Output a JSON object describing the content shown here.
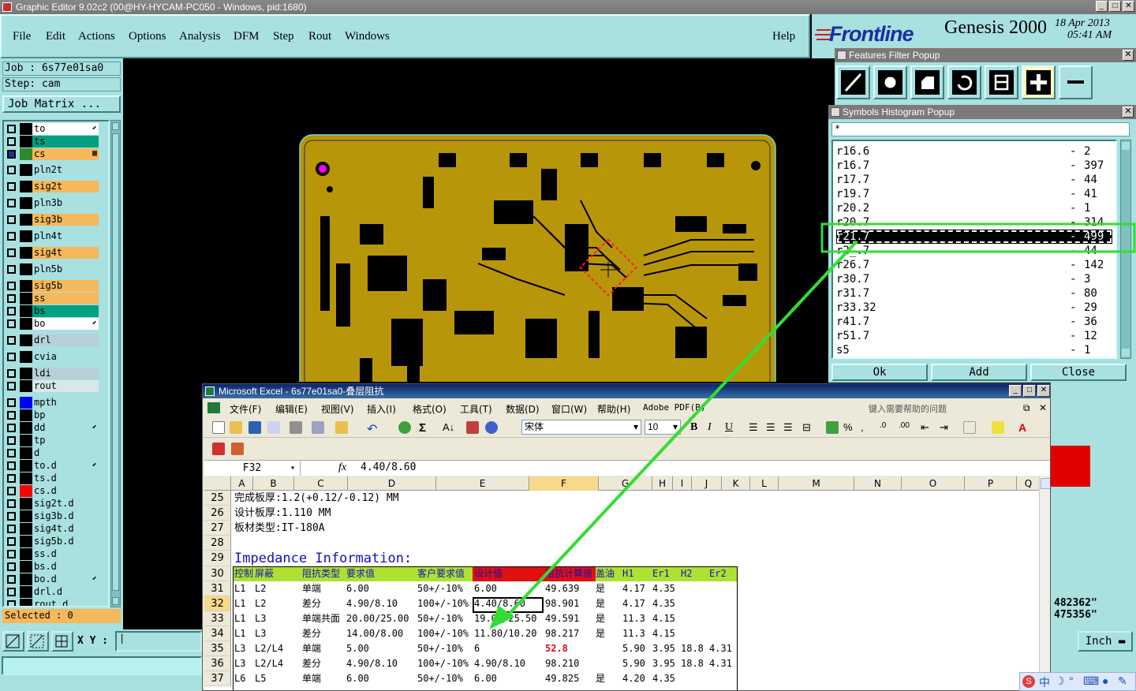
{
  "window": {
    "title": "Graphic Editor 9.02c2 (00@HY-HYCAM-PC050 - Windows, pid:1680)"
  },
  "menu": [
    "File",
    "Edit",
    "Actions",
    "Options",
    "Analysis",
    "DFM",
    "Step",
    "Rout",
    "Windows"
  ],
  "help": "Help",
  "brand": {
    "logo": "Frontline",
    "product": "Genesis 2000",
    "date": "18 Apr 2013",
    "time": "05:41 AM"
  },
  "job": {
    "job_line": "Job : 6s77e01sa0",
    "step_line": "Step: cam",
    "matrix_button": "Job Matrix ..."
  },
  "layers": [
    {
      "name": "to",
      "color": "#ffffff",
      "bg": "#ffffff",
      "mark": "⬋",
      "swatch": "#000000"
    },
    {
      "name": "ts",
      "color": "#00a080",
      "bg": "#00a080",
      "mark": "",
      "swatch": "#000000"
    },
    {
      "name": "cs",
      "color": "#f5b85a",
      "bg": "#f5b85a",
      "mark": "▦",
      "swatch": "#2c8a2c",
      "checked": true
    },
    {
      "name": "pln2t",
      "bg": "#a9e0e0",
      "swatch": "#000000"
    },
    {
      "name": "sig2t",
      "bg": "#f5b85a",
      "swatch": "#000000"
    },
    {
      "name": "pln3b",
      "bg": "#a9e0e0",
      "swatch": "#000000"
    },
    {
      "name": "sig3b",
      "bg": "#f5b85a",
      "swatch": "#000000"
    },
    {
      "name": "pln4t",
      "bg": "#a9e0e0",
      "swatch": "#000000"
    },
    {
      "name": "sig4t",
      "bg": "#f5b85a",
      "swatch": "#000000"
    },
    {
      "name": "pln5b",
      "bg": "#a9e0e0",
      "swatch": "#000000"
    },
    {
      "name": "sig5b",
      "bg": "#f5b85a",
      "swatch": "#000000"
    },
    {
      "name": "ss",
      "bg": "#f5b85a",
      "swatch": "#000000"
    },
    {
      "name": "bs",
      "bg": "#00a080",
      "swatch": "#000000"
    },
    {
      "name": "bo",
      "bg": "#ffffff",
      "mark": "⬋",
      "swatch": "#000000"
    },
    {
      "name": "drl",
      "bg": "#b8d0d8",
      "swatch": "#000000"
    },
    {
      "name": "cvia",
      "bg": "#a9e0e0",
      "swatch": "#000000"
    },
    {
      "name": "ldi",
      "bg": "#b8d0d8",
      "swatch": "#000000"
    },
    {
      "name": "rout",
      "bg": "#d8e8e8",
      "swatch": "#000000"
    },
    {
      "name": "mpth",
      "bg": "#a9e0e0",
      "swatch": "#0000ff"
    },
    {
      "name": "bp",
      "bg": "#a9e0e0",
      "swatch": "#000000"
    },
    {
      "name": "dd",
      "bg": "#a9e0e0",
      "mark": "⬋",
      "swatch": "#000000"
    },
    {
      "name": "tp",
      "bg": "#a9e0e0",
      "swatch": "#000000"
    },
    {
      "name": "d",
      "bg": "#a9e0e0",
      "swatch": "#000000"
    },
    {
      "name": "to.d",
      "bg": "#a9e0e0",
      "mark": "⬋",
      "swatch": "#000000"
    },
    {
      "name": "ts.d",
      "bg": "#a9e0e0",
      "swatch": "#000000"
    },
    {
      "name": "cs.d",
      "bg": "#a9e0e0",
      "swatch": "#ff0000"
    },
    {
      "name": "sig2t.d",
      "bg": "#a9e0e0",
      "swatch": "#000000"
    },
    {
      "name": "sig3b.d",
      "bg": "#a9e0e0",
      "swatch": "#000000"
    },
    {
      "name": "sig4t.d",
      "bg": "#a9e0e0",
      "swatch": "#000000"
    },
    {
      "name": "sig5b.d",
      "bg": "#a9e0e0",
      "swatch": "#000000"
    },
    {
      "name": "ss.d",
      "bg": "#a9e0e0",
      "swatch": "#000000"
    },
    {
      "name": "bs.d",
      "bg": "#a9e0e0",
      "swatch": "#000000"
    },
    {
      "name": "bo.d",
      "bg": "#a9e0e0",
      "mark": "⬋",
      "swatch": "#000000"
    },
    {
      "name": "drl.d",
      "bg": "#a9e0e0",
      "swatch": "#000000"
    },
    {
      "name": "rout.d",
      "bg": "#a9e0e0",
      "swatch": "#000000"
    }
  ],
  "selected": "Selected : 0",
  "coords": {
    "label": "X Y :",
    "value": "|",
    "x_readout": "482362\"",
    "y_readout": "475356\"",
    "units": "Inch"
  },
  "features_filter": {
    "title": "Features Filter Popup"
  },
  "symbols_histogram": {
    "title": "Symbols Histogram Popup",
    "filter": "*",
    "rows": [
      {
        "sym": "r16.6",
        "sep": "-",
        "count": "2"
      },
      {
        "sym": "r16.7",
        "sep": "-",
        "count": "397"
      },
      {
        "sym": "r17.7",
        "sep": "-",
        "count": "44"
      },
      {
        "sym": "r19.7",
        "sep": "-",
        "count": "41"
      },
      {
        "sym": "r20.2",
        "sep": "-",
        "count": "1"
      },
      {
        "sym": "r20.7",
        "sep": "-",
        "count": "314"
      },
      {
        "sym": "r21.7",
        "sep": "-",
        "count": "499",
        "selected": true
      },
      {
        "sym": "r2_.7",
        "sep": "-",
        "count": "44"
      },
      {
        "sym": "r26.7",
        "sep": "-",
        "count": "142"
      },
      {
        "sym": "r30.7",
        "sep": "-",
        "count": "3"
      },
      {
        "sym": "r31.7",
        "sep": "-",
        "count": "80"
      },
      {
        "sym": "r33.32",
        "sep": "-",
        "count": "29"
      },
      {
        "sym": "r41.7",
        "sep": "-",
        "count": "36"
      },
      {
        "sym": "r51.7",
        "sep": "-",
        "count": "12"
      },
      {
        "sym": "s5",
        "sep": "-",
        "count": "1"
      }
    ],
    "buttons": [
      "Ok",
      "Add",
      "Close"
    ]
  },
  "excel": {
    "title": "Microsoft Excel - 6s77e01sa0-叠层阻抗",
    "menu": [
      "文件(F)",
      "编辑(E)",
      "视图(V)",
      "插入(I)",
      "格式(O)",
      "工具(T)",
      "数据(D)",
      "窗口(W)",
      "帮助(H)",
      "Adobe PDF(B)"
    ],
    "help_box": "键入需要帮助的问题",
    "font": "宋体",
    "font_size": "10",
    "name_box": "F32",
    "fx": "fx",
    "formula": "4.40/8.60",
    "columns": [
      "A",
      "B",
      "C",
      "D",
      "E",
      "F",
      "G",
      "H",
      "I",
      "J",
      "K",
      "L",
      "M",
      "N",
      "O",
      "P",
      "Q"
    ],
    "rows": [
      {
        "n": "25",
        "text": "完成板厚:1.2(+0.12/-0.12) MM"
      },
      {
        "n": "26",
        "text": "设计板厚:1.110 MM"
      },
      {
        "n": "27",
        "text": "板材类型:IT-180A"
      },
      {
        "n": "28",
        "text": ""
      },
      {
        "n": "29",
        "text": "Impedance Information:"
      }
    ],
    "table_header": [
      "控制",
      "屏蔽",
      "阻抗类型",
      "要求值",
      "客户要求值",
      "设计值",
      "阻抗计算值",
      "盖油",
      "H1",
      "Er1",
      "H2",
      "Er2"
    ],
    "table_rows": [
      {
        "n": "31",
        "cells": [
          "L1",
          "L2",
          "单端",
          "6.00",
          "50+/-10%",
          "6.00",
          "49.639",
          "是",
          "4.17",
          "4.35",
          "",
          ""
        ]
      },
      {
        "n": "32",
        "cells": [
          "L1",
          "L2",
          "差分",
          "4.90/8.10",
          "100+/-10%",
          "4.40/8.60",
          "98.901",
          "是",
          "4.17",
          "4.35",
          "",
          ""
        ]
      },
      {
        "n": "33",
        "cells": [
          "L1",
          "L3",
          "单端共面",
          "20.00/25.00",
          "50+/-10%",
          "19.00/25.50",
          "49.591",
          "是",
          "11.3",
          "4.15",
          "",
          ""
        ]
      },
      {
        "n": "34",
        "cells": [
          "L1",
          "L3",
          "差分",
          "14.00/8.00",
          "100+/-10%",
          "11.80/10.20",
          "98.217",
          "是",
          "11.3",
          "4.15",
          "",
          ""
        ]
      },
      {
        "n": "35",
        "cells": [
          "L3",
          "L2/L4",
          "单端",
          "5.00",
          "50+/-10%",
          "6",
          "52.8",
          "",
          "5.90",
          "3.95",
          "18.8",
          "4.31"
        ]
      },
      {
        "n": "36",
        "cells": [
          "L3",
          "L2/L4",
          "差分",
          "4.90/8.10",
          "100+/-10%",
          "4.90/8.10",
          "98.210",
          "",
          "5.90",
          "3.95",
          "18.8",
          "4.31"
        ]
      },
      {
        "n": "37",
        "cells": [
          "L6",
          "L5",
          "单端",
          "6.00",
          "50+/-10%",
          "6.00",
          "49.825",
          "是",
          "4.20",
          "4.35",
          "",
          ""
        ]
      }
    ]
  },
  "tray": {
    "ime": "中"
  },
  "colors": {
    "ui_bg": "#a9e0e0",
    "board": "#b8960a",
    "highlight_green": "#33dd33"
  }
}
